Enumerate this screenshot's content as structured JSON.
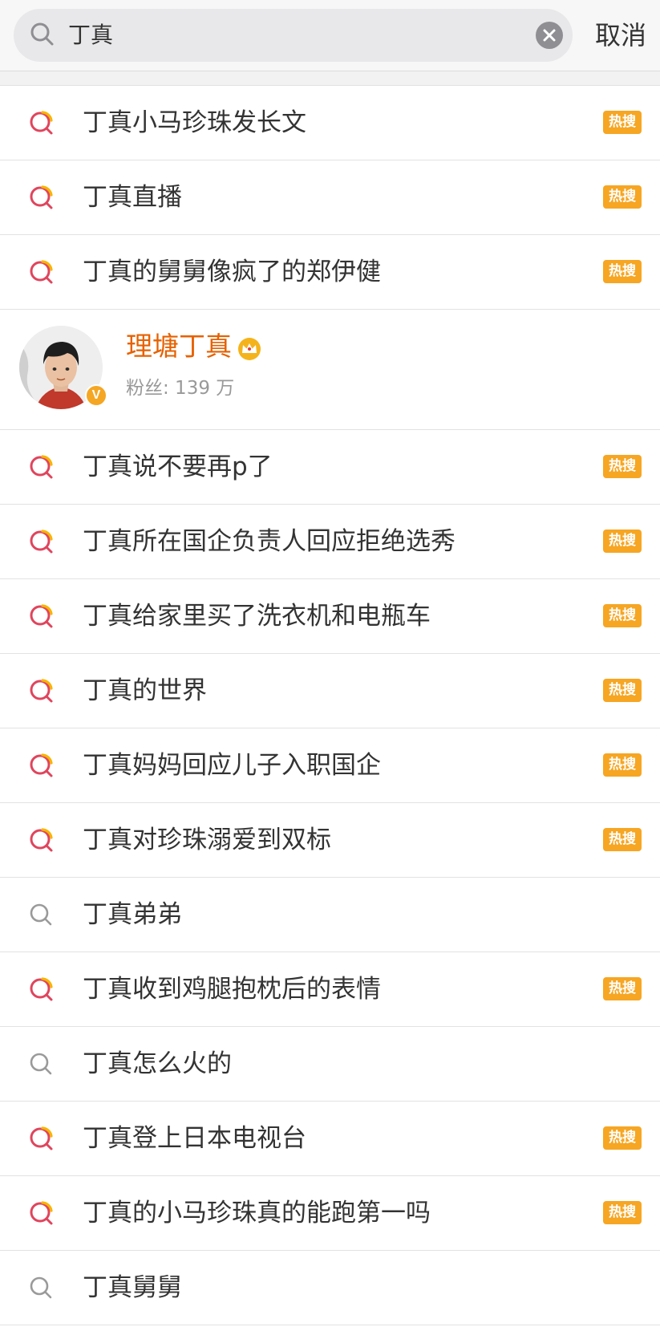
{
  "search": {
    "query": "丁真",
    "cancel_label": "取消"
  },
  "icons": {
    "hot_search": "hot-search-icon",
    "plain_search": "search-icon",
    "clear": "clear-icon",
    "crown": "crown-icon"
  },
  "colors": {
    "hot_badge": "#f6a623",
    "hot_icon_ring": "#e0455d",
    "hot_icon_arc": "#f7b500",
    "username": "#e66100"
  },
  "suggestions_top": [
    {
      "text": "丁真小马珍珠发长文",
      "badge": "热搜"
    },
    {
      "text": "丁真直播",
      "badge": "热搜"
    },
    {
      "text": "丁真的舅舅像疯了的郑伊健",
      "badge": "热搜"
    }
  ],
  "user": {
    "name": "理塘丁真",
    "fans": "粉丝: 139 万",
    "verified_mark": "V"
  },
  "suggestions_bottom": [
    {
      "text": "丁真说不要再p了",
      "badge": "热搜"
    },
    {
      "text": "丁真所在国企负责人回应拒绝选秀",
      "badge": "热搜"
    },
    {
      "text": "丁真给家里买了洗衣机和电瓶车",
      "badge": "热搜"
    },
    {
      "text": "丁真的世界",
      "badge": "热搜"
    },
    {
      "text": "丁真妈妈回应儿子入职国企",
      "badge": "热搜"
    },
    {
      "text": "丁真对珍珠溺爱到双标",
      "badge": "热搜"
    },
    {
      "text": "丁真弟弟",
      "badge": ""
    },
    {
      "text": "丁真收到鸡腿抱枕后的表情",
      "badge": "热搜"
    },
    {
      "text": "丁真怎么火的",
      "badge": ""
    },
    {
      "text": "丁真登上日本电视台",
      "badge": "热搜"
    },
    {
      "text": "丁真的小马珍珠真的能跑第一吗",
      "badge": "热搜"
    },
    {
      "text": "丁真舅舅",
      "badge": ""
    }
  ]
}
